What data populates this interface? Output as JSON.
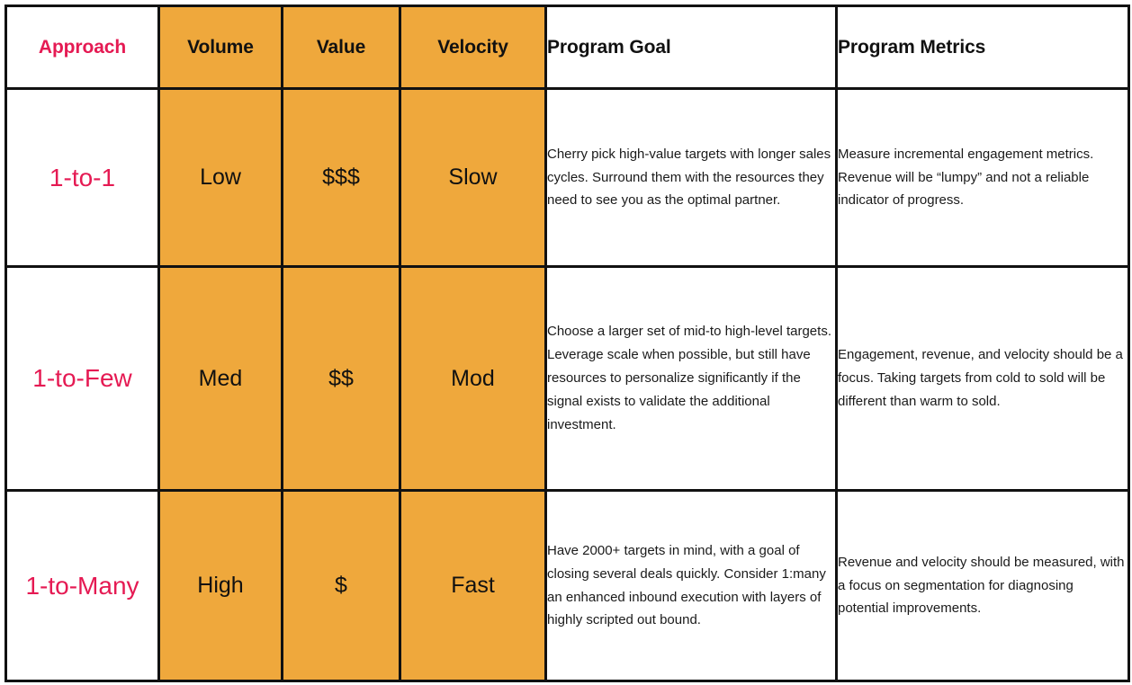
{
  "table": {
    "columns": [
      {
        "key": "approach",
        "label": "Approach",
        "style": "pink"
      },
      {
        "key": "volume",
        "label": "Volume",
        "style": "orange"
      },
      {
        "key": "value",
        "label": "Value",
        "style": "orange"
      },
      {
        "key": "velocity",
        "label": "Velocity",
        "style": "orange"
      },
      {
        "key": "goal",
        "label": "Program Goal",
        "style": "plain"
      },
      {
        "key": "metrics",
        "label": "Program Metrics",
        "style": "plain"
      }
    ],
    "rows": [
      {
        "approach": "1-to-1",
        "volume": "Low",
        "value": "$$$",
        "velocity": "Slow",
        "goal": "Cherry pick high-value targets with longer sales cycles. Surround them with the resources they need to see you as the optimal partner.",
        "metrics": "Measure incremental engagement metrics. Revenue will be “lumpy” and not a reliable indicator of progress."
      },
      {
        "approach": "1-to-Few",
        "volume": "Med",
        "value": "$$",
        "velocity": "Mod",
        "goal": "Choose a larger set of mid-to high-level targets. Leverage scale when possible, but still have resources to personalize significantly if the signal exists to validate the additional investment.",
        "metrics": "Engagement, revenue, and velocity should be a focus. Taking targets from cold to sold will be different than warm to sold."
      },
      {
        "approach": "1-to-Many",
        "volume": "High",
        "value": "$",
        "velocity": "Fast",
        "goal": "Have 2000+ targets in mind, with a goal of closing several deals quickly. Consider 1:many an enhanced inbound execution with layers of highly scripted out bound.",
        "metrics": "Revenue and velocity should be measured, with a focus on segmentation for diagnosing potential improvements."
      }
    ]
  },
  "colors": {
    "accent_pink": "#E51A53",
    "highlight_orange": "#EFA83C",
    "border": "#111111",
    "text": "#1a1a1a",
    "background": "#ffffff"
  }
}
